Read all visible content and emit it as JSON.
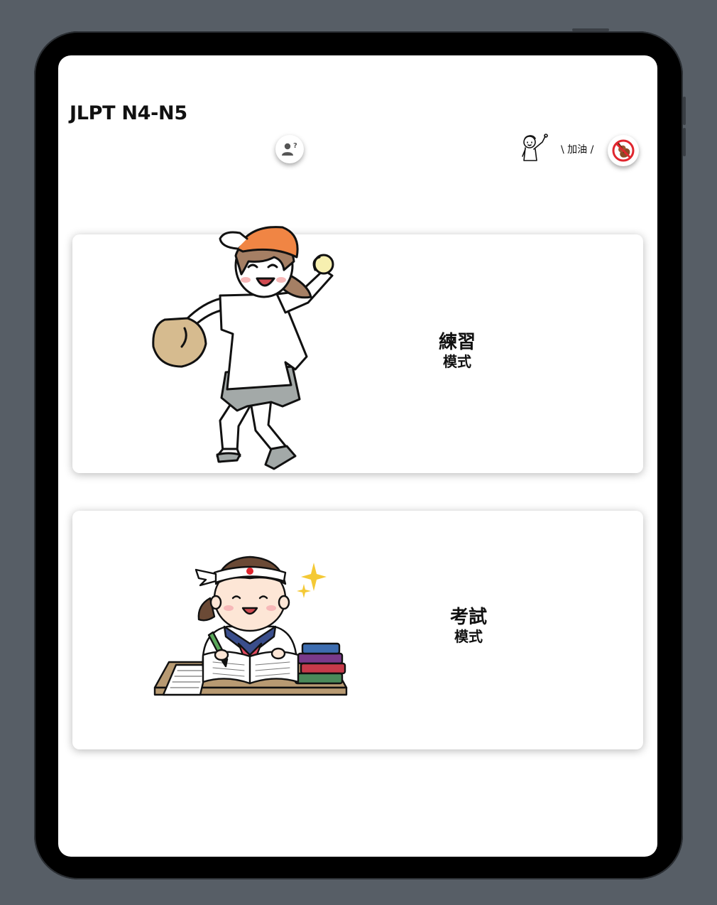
{
  "app": {
    "title": "JLPT N4-N5"
  },
  "header": {
    "help_icon": "user-question-icon",
    "cheer_text": "\\ 加油 /",
    "sound_icon": "muted-guitar-icon"
  },
  "modes": [
    {
      "line1": "練習",
      "line2": "模式",
      "illustration": "baseball-pitcher-girl"
    },
    {
      "line1": "考試",
      "line2": "模式",
      "illustration": "studying-student-girl"
    }
  ],
  "colors": {
    "device_bg": "#575e66",
    "cap_orange": "#f08544",
    "glove_tan": "#d6bb8f",
    "shorts_gray": "#a3a9a8",
    "desk_brown": "#b89a72",
    "sparkle_yellow": "#f4c935",
    "scarf_red": "#e0475c"
  }
}
